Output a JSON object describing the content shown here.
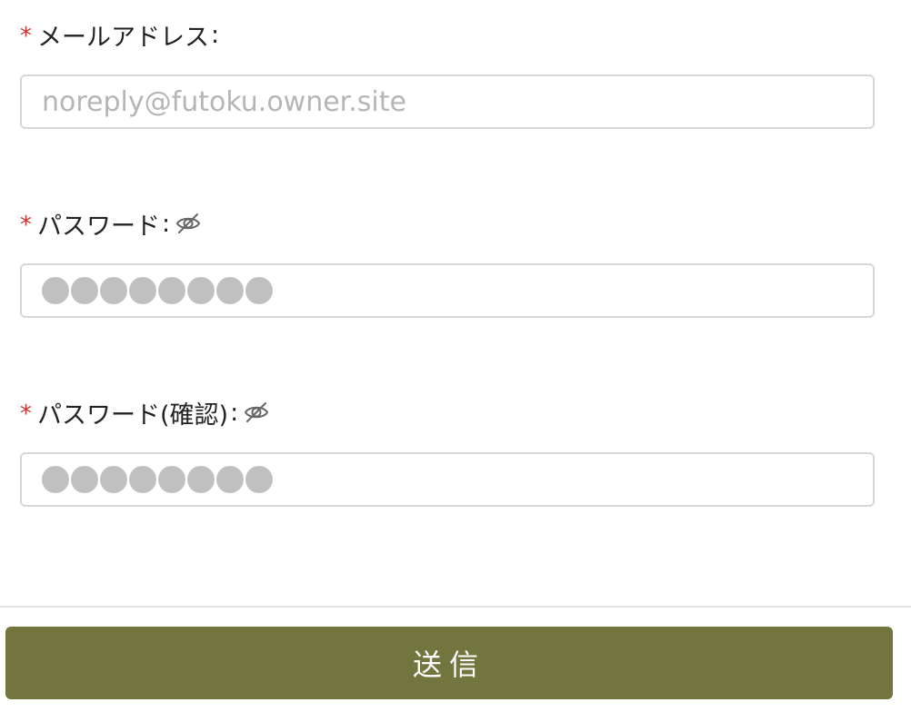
{
  "form": {
    "email": {
      "required_mark": "*",
      "label": "メールアドレス",
      "colon": ":",
      "placeholder": "noreply@futoku.owner.site",
      "value": ""
    },
    "password": {
      "required_mark": "*",
      "label": "パスワード",
      "colon": ":",
      "toggle_icon": "eye-off-icon",
      "masked_length": 8
    },
    "password_confirm": {
      "required_mark": "*",
      "label": "パスワード(確認)",
      "colon": ":",
      "toggle_icon": "eye-off-icon",
      "masked_length": 8
    },
    "submit_label": "送信"
  },
  "colors": {
    "required": "#d9342b",
    "button": "#72753d",
    "input_border": "#d6d6d6",
    "placeholder": "#b5b5b5",
    "mask_dot": "#c0c0c0"
  }
}
